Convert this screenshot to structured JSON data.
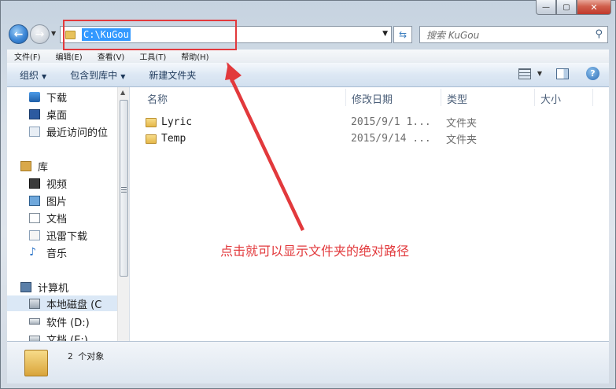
{
  "window": {
    "minimize_label": "—",
    "maximize_label": "▢",
    "close_label": "✕"
  },
  "nav": {
    "back_label": "←",
    "forward_label": "→",
    "address": "C:\\KuGou",
    "search_placeholder": "搜索 KuGou"
  },
  "menu": [
    "文件(F)",
    "编辑(E)",
    "查看(V)",
    "工具(T)",
    "帮助(H)"
  ],
  "toolbar": {
    "organize": "组织",
    "include_library": "包含到库中",
    "new_folder": "新建文件夹"
  },
  "sidebar": {
    "items": [
      {
        "label": "下载",
        "icon": "download-folder-icon"
      },
      {
        "label": "桌面",
        "icon": "desktop-icon"
      },
      {
        "label": "最近访问的位",
        "icon": "recent-places-icon"
      },
      {
        "label": "库",
        "icon": "library-icon"
      },
      {
        "label": "视频",
        "icon": "video-library-icon"
      },
      {
        "label": "图片",
        "icon": "pictures-library-icon"
      },
      {
        "label": "文档",
        "icon": "documents-library-icon"
      },
      {
        "label": "迅雷下载",
        "icon": "xunlei-download-icon"
      },
      {
        "label": "音乐",
        "icon": "music-library-icon"
      },
      {
        "label": "计算机",
        "icon": "computer-icon"
      },
      {
        "label": "本地磁盘 (C",
        "icon": "local-disk-icon"
      },
      {
        "label": "软件 (D:)",
        "icon": "drive-d-icon"
      },
      {
        "label": "文档 (E:)",
        "icon": "drive-e-icon"
      }
    ]
  },
  "columns": {
    "name": "名称",
    "date": "修改日期",
    "type": "类型",
    "size": "大小"
  },
  "files": [
    {
      "name": "Lyric",
      "date": "2015/9/1 1...",
      "type": "文件夹"
    },
    {
      "name": "Temp",
      "date": "2015/9/14 ...",
      "type": "文件夹"
    }
  ],
  "annotation": "点击就可以显示文件夹的绝对路径",
  "status": {
    "count": "2 个对象"
  },
  "colors": {
    "annotation_red": "#e2393c",
    "selection_blue": "#3399ff"
  }
}
